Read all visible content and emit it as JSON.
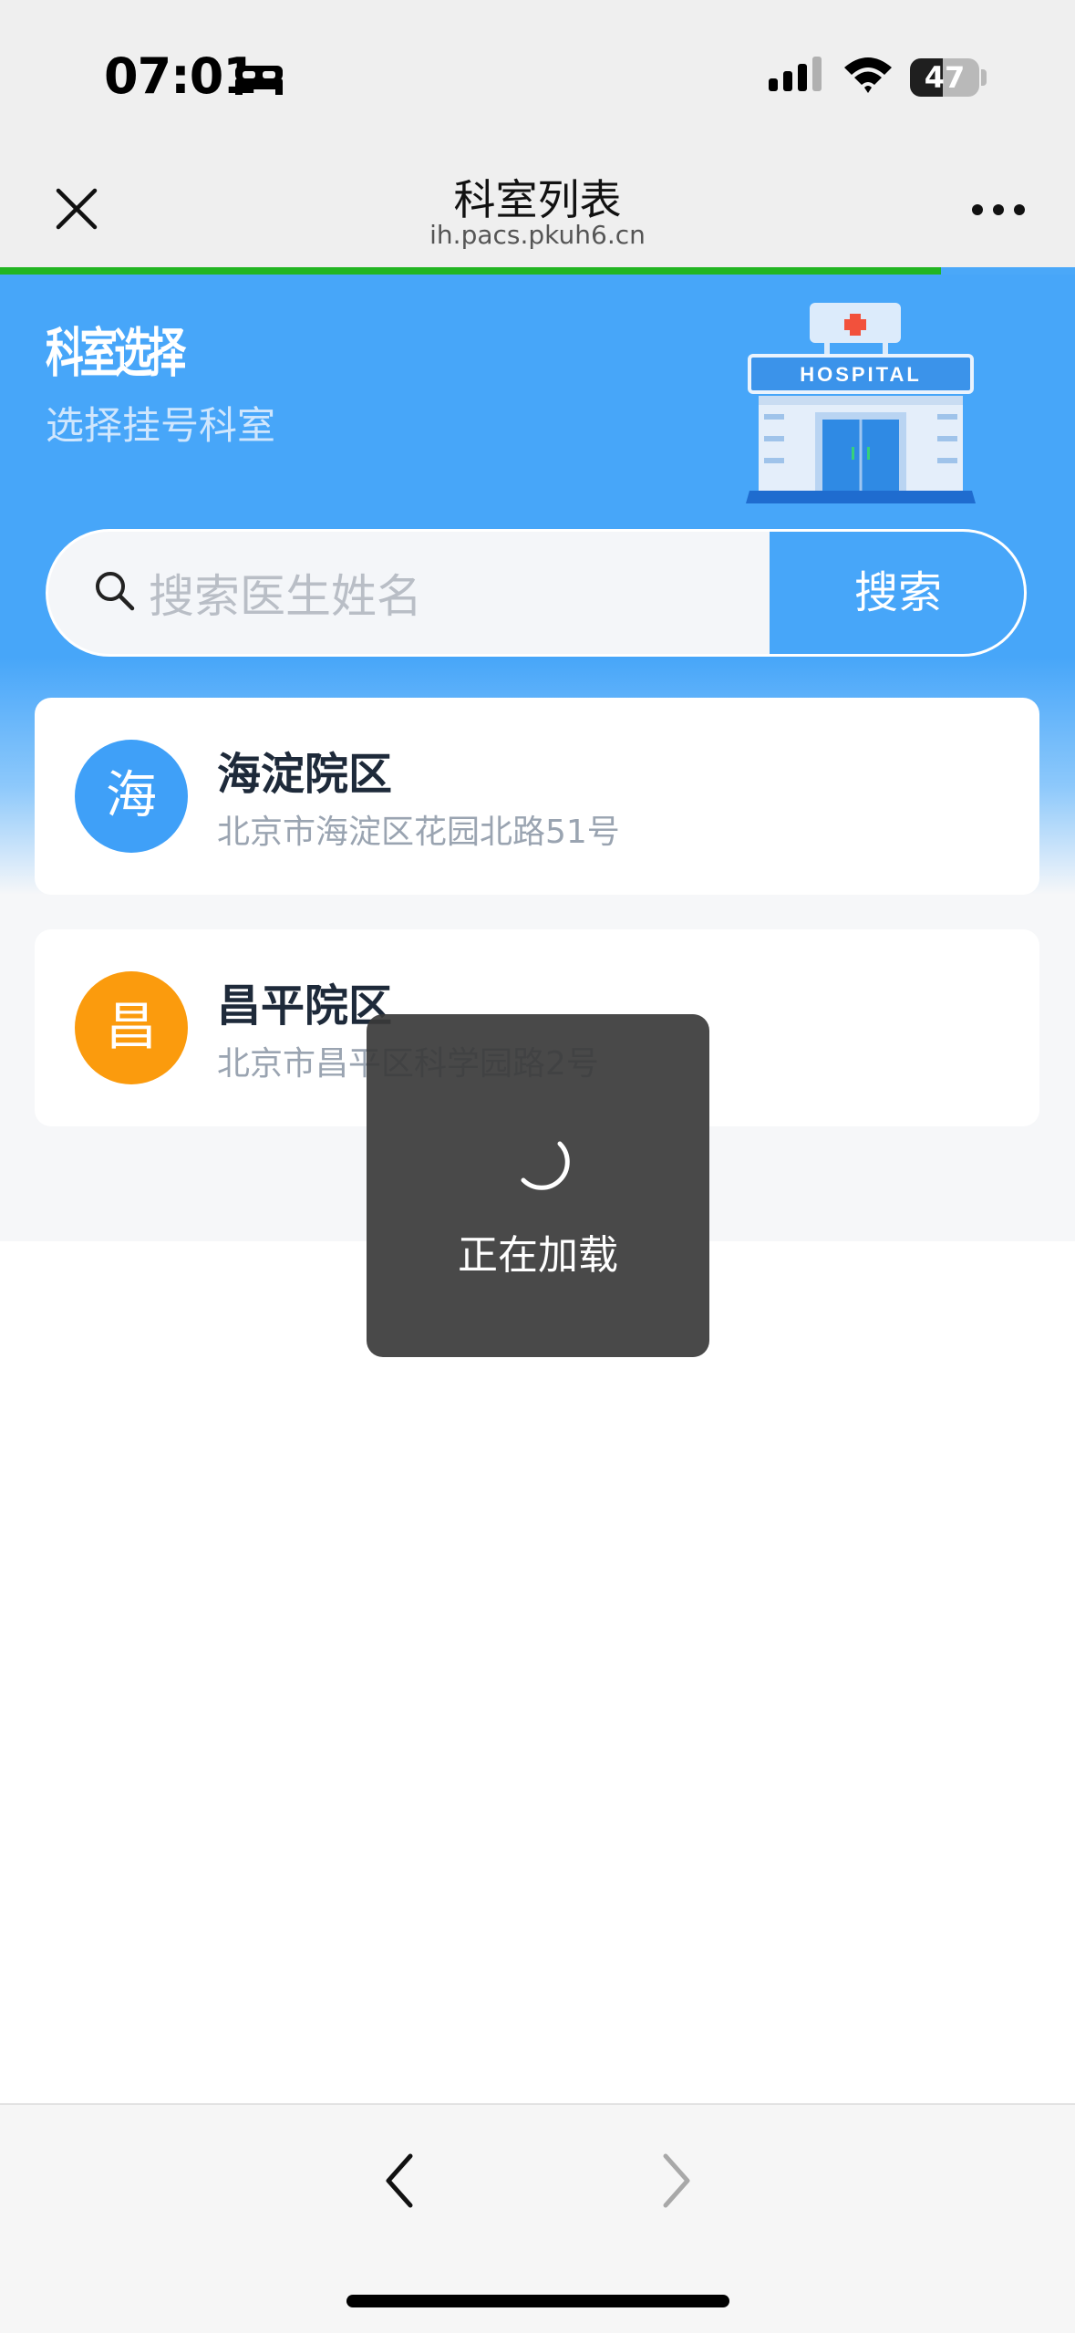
{
  "status_bar": {
    "time": "07:01",
    "battery_level": "47",
    "battery_fraction": 0.47
  },
  "nav": {
    "title": "科室列表",
    "url": "ih.pacs.pkuh6.cn",
    "page_load_progress": 0.875
  },
  "hero": {
    "title": "科室选择",
    "subtitle": "选择挂号科室",
    "sign_text": "HOSPITAL"
  },
  "search": {
    "placeholder": "搜索医生姓名",
    "value": "",
    "button_label": "搜索"
  },
  "campuses": [
    {
      "avatar_char": "海",
      "name": "海淀院区",
      "address": "北京市海淀区花园北路51号",
      "color": "#3fa0f8"
    },
    {
      "avatar_char": "昌",
      "name": "昌平院区",
      "address": "北京市昌平区科学园路2号",
      "color": "#fb9b0d"
    }
  ],
  "toast": {
    "text": "正在加载"
  },
  "icons": [
    "bed-icon",
    "signal-icon",
    "wifi-icon",
    "close-icon",
    "more-icon",
    "search-icon",
    "hospital-illustration",
    "spinner-icon",
    "back-arrow-icon",
    "forward-arrow-icon"
  ]
}
